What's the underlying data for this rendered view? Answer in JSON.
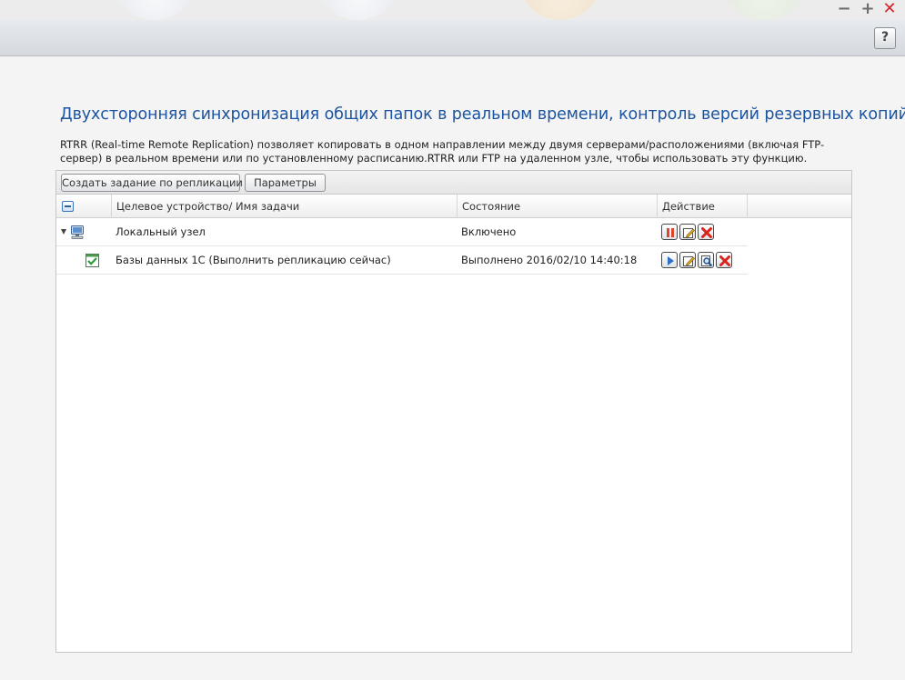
{
  "window": {
    "minimize": "−",
    "maximize": "+",
    "close": "✕",
    "help": "?"
  },
  "page": {
    "title": "Двухсторонняя синхронизация общих папок в реальном времени, контроль версий резервных копий",
    "description": "RTRR (Real-time Remote Replication) позволяет копировать в одном направлении между двумя серверами/расположениями (включая FTP-сервер) в реальном времени или по установленному расписанию.RTRR или FTP на удаленном узле, чтобы использовать эту функцию."
  },
  "toolbar": {
    "create_label": "Создать задание по репликации",
    "params_label": "Параметры"
  },
  "table": {
    "headers": [
      "",
      "Целевое устройство/ Имя задачи",
      "Состояние",
      "Действие"
    ],
    "rows": [
      {
        "name": "Локальный узел",
        "status": "Включено",
        "actions": [
          "pause-icon",
          "edit-icon",
          "delete-icon"
        ]
      },
      {
        "name": "Базы данных 1С (Выполнить репликацию сейчас)",
        "status": "Выполнено 2016/02/10 14:40:18",
        "actions": [
          "play-icon",
          "edit-icon",
          "view-log-icon",
          "delete-icon"
        ]
      }
    ]
  },
  "colors": {
    "title": "#1b54a0",
    "pause": "#e0452e",
    "delete": "#d8241c",
    "play": "#2f6fc8",
    "check": "#2a9a3a"
  }
}
